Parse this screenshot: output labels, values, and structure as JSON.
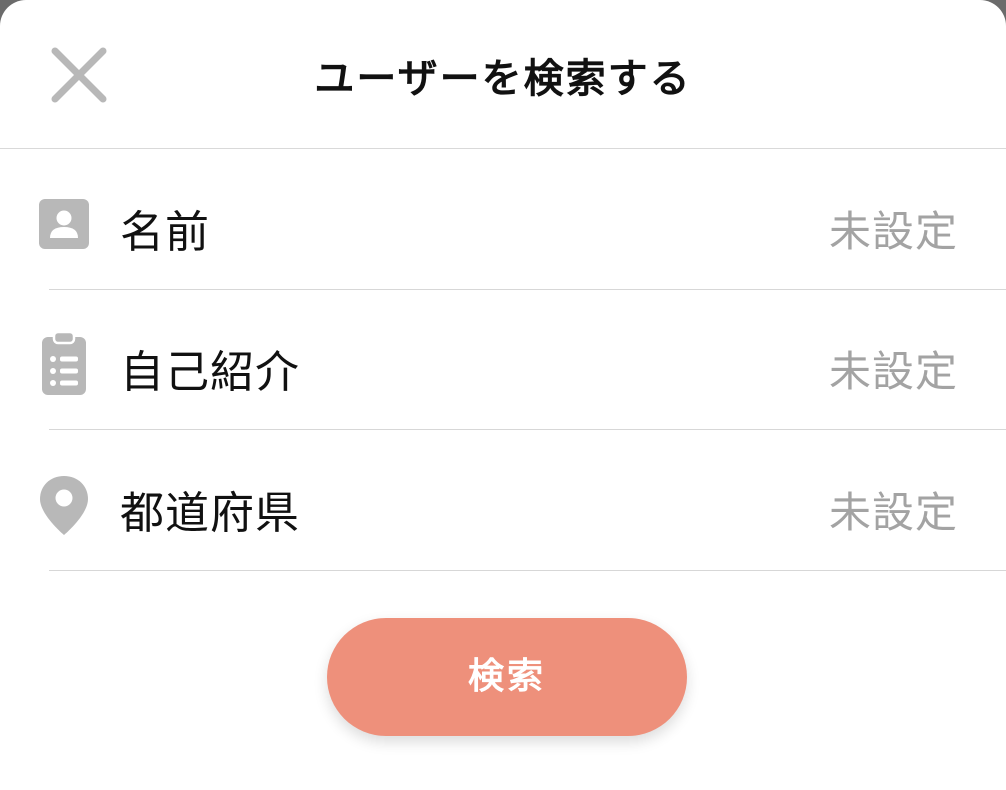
{
  "header": {
    "title": "ユーザーを検索する",
    "close_icon": "close-icon"
  },
  "fields": [
    {
      "label": "名前",
      "value": "未設定",
      "icon": "person-icon"
    },
    {
      "label": "自己紹介",
      "value": "未設定",
      "icon": "clipboard-icon"
    },
    {
      "label": "都道府県",
      "value": "未設定",
      "icon": "location-pin-icon"
    }
  ],
  "search_button": {
    "label": "検索"
  },
  "colors": {
    "accent": "#ee907b",
    "icon_gray": "#b8b8b8",
    "placeholder_gray": "#a3a3a3",
    "text": "#111111",
    "divider": "#d7d7d7"
  }
}
